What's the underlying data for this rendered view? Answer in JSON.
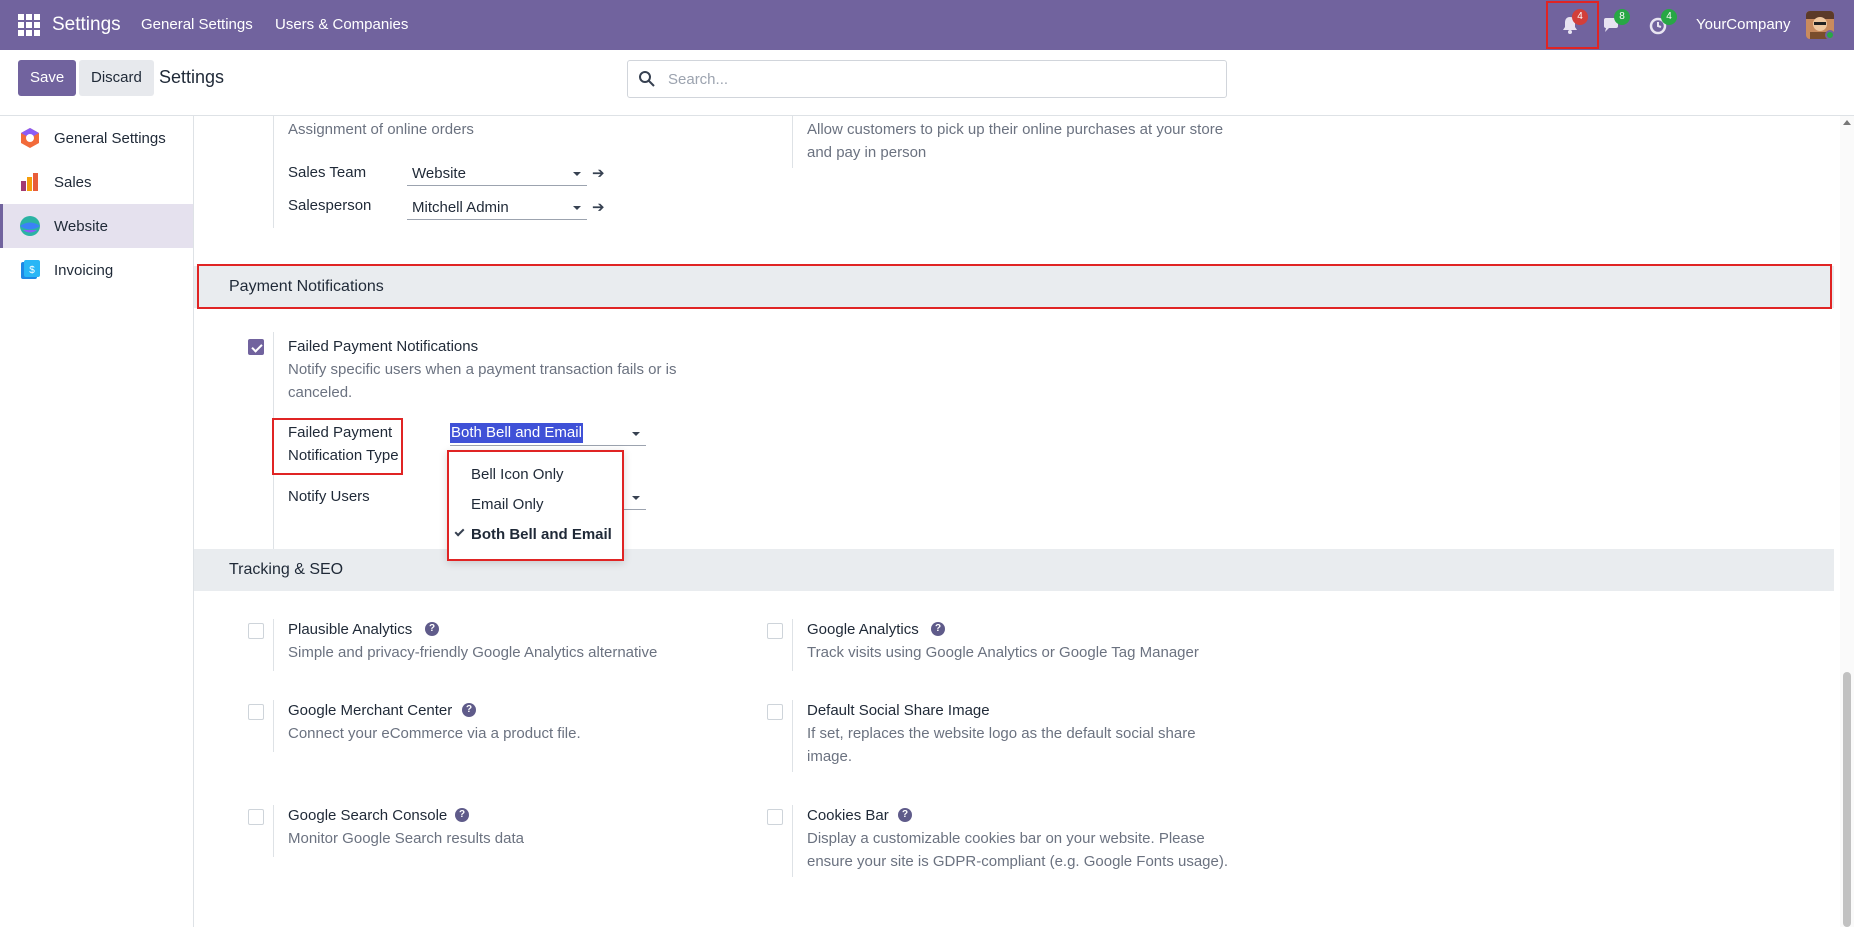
{
  "navbar": {
    "app_title": "Settings",
    "menus": [
      "General Settings",
      "Users & Companies"
    ],
    "bell_count": "4",
    "chat_count": "8",
    "activity_count": "4",
    "company": "YourCompany"
  },
  "control": {
    "save": "Save",
    "discard": "Discard",
    "title": "Settings",
    "search_placeholder": "Search..."
  },
  "sidebar": {
    "items": [
      {
        "label": "General Settings"
      },
      {
        "label": "Sales"
      },
      {
        "label": "Website"
      },
      {
        "label": "Invoicing"
      }
    ]
  },
  "top_section": {
    "assignment_desc": "Assignment of online orders",
    "sales_team_label": "Sales Team",
    "sales_team_value": "Website",
    "salesperson_label": "Salesperson",
    "salesperson_value": "Mitchell Admin",
    "pickup_desc_1": "Allow customers to pick up their online purchases at your store",
    "pickup_desc_2": "and pay in person"
  },
  "payment": {
    "section_title": "Payment Notifications",
    "failed_title": "Failed Payment Notifications",
    "failed_desc_1": "Notify specific users when a payment transaction fails or is",
    "failed_desc_2": "canceled.",
    "type_label_1": "Failed Payment",
    "type_label_2": "Notification Type",
    "type_value": "Both Bell and Email",
    "notify_label": "Notify Users",
    "options": [
      "Bell Icon Only",
      "Email Only",
      "Both Bell and Email"
    ]
  },
  "tracking": {
    "section_title": "Tracking & SEO",
    "plausible_title": "Plausible Analytics",
    "plausible_desc": "Simple and privacy-friendly Google Analytics alternative",
    "ga_title": "Google Analytics",
    "ga_desc": "Track visits using Google Analytics or Google Tag Manager",
    "merchant_title": "Google Merchant Center",
    "merchant_desc": "Connect your eCommerce via a product file.",
    "social_title": "Default Social Share Image",
    "social_desc_1": "If set, replaces the website logo as the default social share",
    "social_desc_2": "image.",
    "console_title": "Google Search Console",
    "console_desc": "Monitor Google Search results data",
    "cookies_title": "Cookies Bar",
    "cookies_desc_1": "Display a customizable cookies bar on your website. Please",
    "cookies_desc_2": "ensure your site is GDPR-compliant (e.g. Google Fonts usage).",
    "help": "?"
  },
  "colors": {
    "navbar": "#71639e",
    "accent": "#71639e",
    "highlight": "#e02424"
  }
}
